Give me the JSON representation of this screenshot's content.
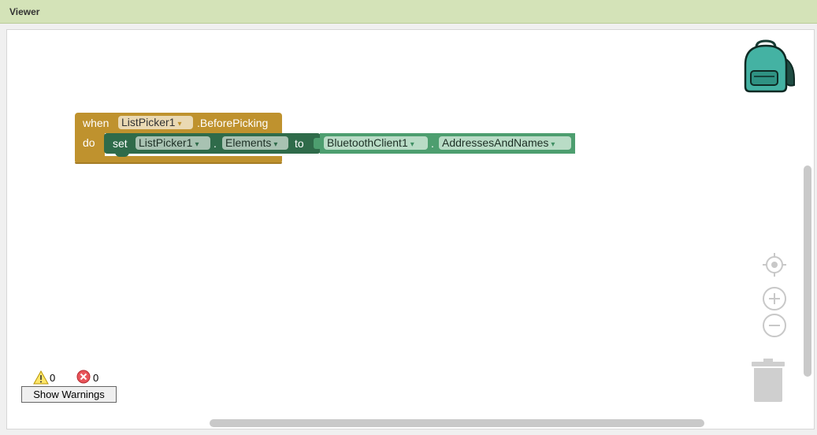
{
  "panel": {
    "title": "Viewer"
  },
  "event_block": {
    "when_label": "when",
    "component": "ListPicker1",
    "event": ".BeforePicking",
    "do_label": "do",
    "color": "#bf922e"
  },
  "set_block": {
    "set_label": "set",
    "component": "ListPicker1",
    "dot": ".",
    "property": "Elements",
    "to_label": "to",
    "color": "#2f6b4a"
  },
  "getter_block": {
    "component": "BluetoothClient1",
    "dot": ".",
    "property": "AddressesAndNames",
    "color": "#4d9e6f"
  },
  "dropdown_arrow": "▾",
  "icons": {
    "backpack": "backpack-icon",
    "recenter": "crosshair-icon",
    "zoom_in": "zoom-in-icon",
    "zoom_out": "zoom-out-icon",
    "trash": "trash-icon",
    "warning": "warning-icon",
    "error": "error-icon"
  },
  "status": {
    "warnings_count": "0",
    "errors_count": "0",
    "show_warnings_label": "Show Warnings"
  }
}
